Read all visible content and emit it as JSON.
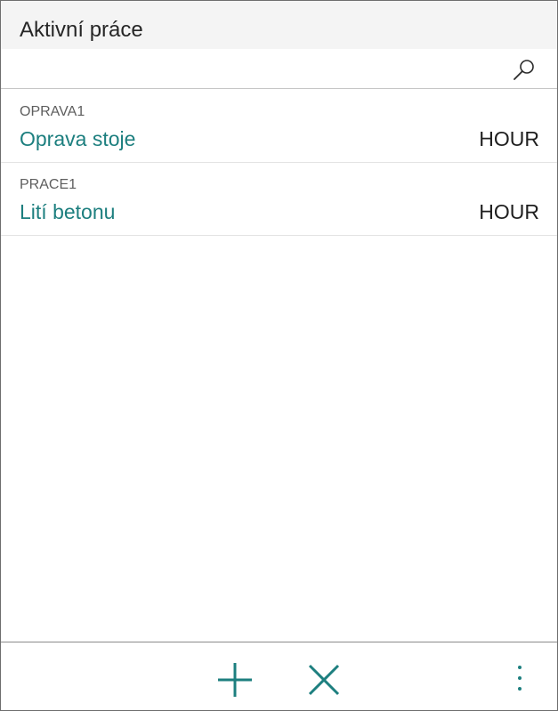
{
  "header": {
    "title": "Aktivní práce"
  },
  "search": {
    "icon": "search-icon"
  },
  "list": {
    "items": [
      {
        "code": "OPRAVA1",
        "name": "Oprava stoje",
        "unit": "HOUR"
      },
      {
        "code": "PRACE1",
        "name": "Lití betonu",
        "unit": "HOUR"
      }
    ]
  },
  "footer": {
    "actions": [
      {
        "name": "add",
        "icon": "plus-icon"
      },
      {
        "name": "delete",
        "icon": "close-icon"
      },
      {
        "name": "more",
        "icon": "more-vertical-icon"
      }
    ]
  },
  "colors": {
    "accent": "#1d7f7f",
    "header_bg": "#f4f4f4",
    "text": "#262626"
  }
}
